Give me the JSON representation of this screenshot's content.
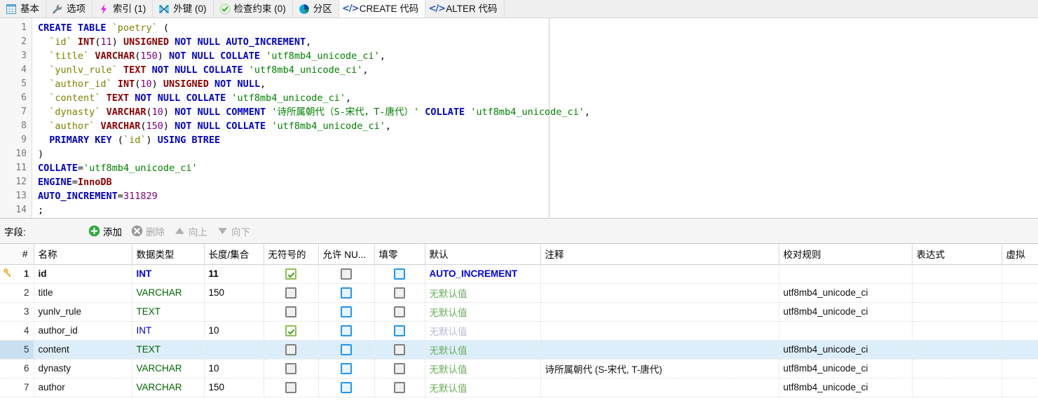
{
  "tabs": [
    {
      "label": "基本",
      "icon": "table-grid-icon",
      "active": false
    },
    {
      "label": "选项",
      "icon": "wrench-icon",
      "active": false
    },
    {
      "label": "索引 (1)",
      "icon": "lightning-icon",
      "active": false
    },
    {
      "label": "外键 (0)",
      "icon": "foreign-key-icon",
      "active": false
    },
    {
      "label": "检查约束 (0)",
      "icon": "check-circle-icon",
      "active": false
    },
    {
      "label": "分区",
      "icon": "pie-chart-icon",
      "active": false
    },
    {
      "label": "CREATE 代码",
      "icon": "code-brackets-icon",
      "active": true
    },
    {
      "label": "ALTER 代码",
      "icon": "code-brackets-icon",
      "active": false
    }
  ],
  "editor": {
    "line_numbers": [
      "1",
      "2",
      "3",
      "4",
      "5",
      "6",
      "7",
      "8",
      "9",
      "10",
      "11",
      "12",
      "13",
      "14"
    ],
    "lines": [
      [
        {
          "t": "CREATE TABLE ",
          "c": "k"
        },
        {
          "t": "`poetry`",
          "c": "id"
        },
        {
          "t": " (",
          "c": "pl"
        }
      ],
      [
        {
          "t": "  ",
          "c": "pl"
        },
        {
          "t": "`id`",
          "c": "id"
        },
        {
          "t": " ",
          "c": "pl"
        },
        {
          "t": "INT",
          "c": "kt"
        },
        {
          "t": "(",
          "c": "pl"
        },
        {
          "t": "11",
          "c": "nm"
        },
        {
          "t": ") ",
          "c": "pl"
        },
        {
          "t": "UNSIGNED",
          "c": "kt"
        },
        {
          "t": " ",
          "c": "pl"
        },
        {
          "t": "NOT NULL AUTO_INCREMENT",
          "c": "k"
        },
        {
          "t": ",",
          "c": "pl"
        }
      ],
      [
        {
          "t": "  ",
          "c": "pl"
        },
        {
          "t": "`title`",
          "c": "id"
        },
        {
          "t": " ",
          "c": "pl"
        },
        {
          "t": "VARCHAR",
          "c": "kt"
        },
        {
          "t": "(",
          "c": "pl"
        },
        {
          "t": "150",
          "c": "nm"
        },
        {
          "t": ") ",
          "c": "pl"
        },
        {
          "t": "NOT NULL COLLATE",
          "c": "k"
        },
        {
          "t": " ",
          "c": "pl"
        },
        {
          "t": "'utf8mb4_unicode_ci'",
          "c": "st"
        },
        {
          "t": ",",
          "c": "pl"
        }
      ],
      [
        {
          "t": "  ",
          "c": "pl"
        },
        {
          "t": "`yunlv_rule`",
          "c": "id"
        },
        {
          "t": " ",
          "c": "pl"
        },
        {
          "t": "TEXT",
          "c": "kt"
        },
        {
          "t": " ",
          "c": "pl"
        },
        {
          "t": "NOT NULL COLLATE",
          "c": "k"
        },
        {
          "t": " ",
          "c": "pl"
        },
        {
          "t": "'utf8mb4_unicode_ci'",
          "c": "st"
        },
        {
          "t": ",",
          "c": "pl"
        }
      ],
      [
        {
          "t": "  ",
          "c": "pl"
        },
        {
          "t": "`author_id`",
          "c": "id"
        },
        {
          "t": " ",
          "c": "pl"
        },
        {
          "t": "INT",
          "c": "kt"
        },
        {
          "t": "(",
          "c": "pl"
        },
        {
          "t": "10",
          "c": "nm"
        },
        {
          "t": ") ",
          "c": "pl"
        },
        {
          "t": "UNSIGNED",
          "c": "kt"
        },
        {
          "t": " ",
          "c": "pl"
        },
        {
          "t": "NOT NULL",
          "c": "k"
        },
        {
          "t": ",",
          "c": "pl"
        }
      ],
      [
        {
          "t": "  ",
          "c": "pl"
        },
        {
          "t": "`content`",
          "c": "id"
        },
        {
          "t": " ",
          "c": "pl"
        },
        {
          "t": "TEXT",
          "c": "kt"
        },
        {
          "t": " ",
          "c": "pl"
        },
        {
          "t": "NOT NULL COLLATE",
          "c": "k"
        },
        {
          "t": " ",
          "c": "pl"
        },
        {
          "t": "'utf8mb4_unicode_ci'",
          "c": "st"
        },
        {
          "t": ",",
          "c": "pl"
        }
      ],
      [
        {
          "t": "  ",
          "c": "pl"
        },
        {
          "t": "`dynasty`",
          "c": "id"
        },
        {
          "t": " ",
          "c": "pl"
        },
        {
          "t": "VARCHAR",
          "c": "kt"
        },
        {
          "t": "(",
          "c": "pl"
        },
        {
          "t": "10",
          "c": "nm"
        },
        {
          "t": ") ",
          "c": "pl"
        },
        {
          "t": "NOT NULL COMMENT",
          "c": "k"
        },
        {
          "t": " ",
          "c": "pl"
        },
        {
          "t": "'诗所属朝代（S-宋代，T-唐代）'",
          "c": "st"
        },
        {
          "t": " ",
          "c": "pl"
        },
        {
          "t": "COLLATE",
          "c": "k"
        },
        {
          "t": " ",
          "c": "pl"
        },
        {
          "t": "'utf8mb4_unicode_ci'",
          "c": "st"
        },
        {
          "t": ",",
          "c": "pl"
        }
      ],
      [
        {
          "t": "  ",
          "c": "pl"
        },
        {
          "t": "`author`",
          "c": "id"
        },
        {
          "t": " ",
          "c": "pl"
        },
        {
          "t": "VARCHAR",
          "c": "kt"
        },
        {
          "t": "(",
          "c": "pl"
        },
        {
          "t": "150",
          "c": "nm"
        },
        {
          "t": ") ",
          "c": "pl"
        },
        {
          "t": "NOT NULL COLLATE",
          "c": "k"
        },
        {
          "t": " ",
          "c": "pl"
        },
        {
          "t": "'utf8mb4_unicode_ci'",
          "c": "st"
        },
        {
          "t": ",",
          "c": "pl"
        }
      ],
      [
        {
          "t": "  ",
          "c": "pl"
        },
        {
          "t": "PRIMARY KEY",
          "c": "k"
        },
        {
          "t": " (",
          "c": "pl"
        },
        {
          "t": "`id`",
          "c": "id"
        },
        {
          "t": ") ",
          "c": "pl"
        },
        {
          "t": "USING BTREE",
          "c": "k"
        }
      ],
      [
        {
          "t": ")",
          "c": "pl"
        }
      ],
      [
        {
          "t": "COLLATE",
          "c": "k"
        },
        {
          "t": "=",
          "c": "pl"
        },
        {
          "t": "'utf8mb4_unicode_ci'",
          "c": "st"
        }
      ],
      [
        {
          "t": "ENGINE",
          "c": "k"
        },
        {
          "t": "=",
          "c": "pl"
        },
        {
          "t": "InnoDB",
          "c": "kt"
        }
      ],
      [
        {
          "t": "AUTO_INCREMENT",
          "c": "k"
        },
        {
          "t": "=",
          "c": "pl"
        },
        {
          "t": "311829",
          "c": "nm"
        }
      ],
      [
        {
          "t": ";",
          "c": "pl"
        }
      ]
    ]
  },
  "fieldbar": {
    "caption": "字段:",
    "buttons": [
      {
        "label": "添加",
        "icon": "plus-circle-icon",
        "enabled": true
      },
      {
        "label": "删除",
        "icon": "x-circle-icon",
        "enabled": false
      },
      {
        "label": "向上",
        "icon": "arrow-up-icon",
        "enabled": false
      },
      {
        "label": "向下",
        "icon": "arrow-down-icon",
        "enabled": false
      }
    ]
  },
  "grid": {
    "headers": [
      "#",
      "名称",
      "数据类型",
      "长度/集合",
      "无符号的",
      "允许 NU...",
      "填零",
      "默认",
      "注释",
      "校对规则",
      "表达式",
      "虚拟"
    ],
    "rows": [
      {
        "num": "1",
        "name": "id",
        "type": "INT",
        "type_style": "int",
        "length": "11",
        "unsigned": "checked",
        "nullable": "gray",
        "zerofill": "blue",
        "default": "AUTO_INCREMENT",
        "default_style": "value",
        "comment": "",
        "collation": "",
        "expression": "",
        "virtual": "",
        "pk": true,
        "selected": false
      },
      {
        "num": "2",
        "name": "title",
        "type": "VARCHAR",
        "type_style": "other",
        "length": "150",
        "unsigned": "gray",
        "nullable": "blue",
        "zerofill": "gray",
        "default": "无默认值",
        "default_style": "none",
        "comment": "",
        "collation": "utf8mb4_unicode_ci",
        "expression": "",
        "virtual": "",
        "pk": false,
        "selected": false
      },
      {
        "num": "3",
        "name": "yunlv_rule",
        "type": "TEXT",
        "type_style": "other",
        "length": "",
        "unsigned": "gray",
        "nullable": "blue",
        "zerofill": "gray",
        "default": "无默认值",
        "default_style": "none",
        "comment": "",
        "collation": "utf8mb4_unicode_ci",
        "expression": "",
        "virtual": "",
        "pk": false,
        "selected": false
      },
      {
        "num": "4",
        "name": "author_id",
        "type": "INT",
        "type_style": "int-normal",
        "length": "10",
        "unsigned": "checked",
        "nullable": "blue",
        "zerofill": "blue",
        "default": "无默认值",
        "default_style": "none-fade",
        "comment": "",
        "collation": "",
        "expression": "",
        "virtual": "",
        "pk": false,
        "selected": false
      },
      {
        "num": "5",
        "name": "content",
        "type": "TEXT",
        "type_style": "other",
        "length": "",
        "unsigned": "gray",
        "nullable": "blue",
        "zerofill": "gray",
        "default": "无默认值",
        "default_style": "none",
        "comment": "",
        "collation": "utf8mb4_unicode_ci",
        "expression": "",
        "virtual": "",
        "pk": false,
        "selected": true
      },
      {
        "num": "6",
        "name": "dynasty",
        "type": "VARCHAR",
        "type_style": "other",
        "length": "10",
        "unsigned": "gray",
        "nullable": "blue",
        "zerofill": "gray",
        "default": "无默认值",
        "default_style": "none",
        "comment": "诗所属朝代 (S-宋代, T-唐代)",
        "collation": "utf8mb4_unicode_ci",
        "expression": "",
        "virtual": "",
        "pk": false,
        "selected": false
      },
      {
        "num": "7",
        "name": "author",
        "type": "VARCHAR",
        "type_style": "other",
        "length": "150",
        "unsigned": "gray",
        "nullable": "blue",
        "zerofill": "gray",
        "default": "无默认值",
        "default_style": "none",
        "comment": "",
        "collation": "utf8mb4_unicode_ci",
        "expression": "",
        "virtual": "",
        "pk": false,
        "selected": false
      }
    ]
  },
  "colors": {
    "keyword": "#0000c8",
    "type": "#8b0000",
    "string": "#008000",
    "identifier": "#808000",
    "number": "#800080",
    "selection": "#ddeefb",
    "key_icon": "#f5a623"
  }
}
